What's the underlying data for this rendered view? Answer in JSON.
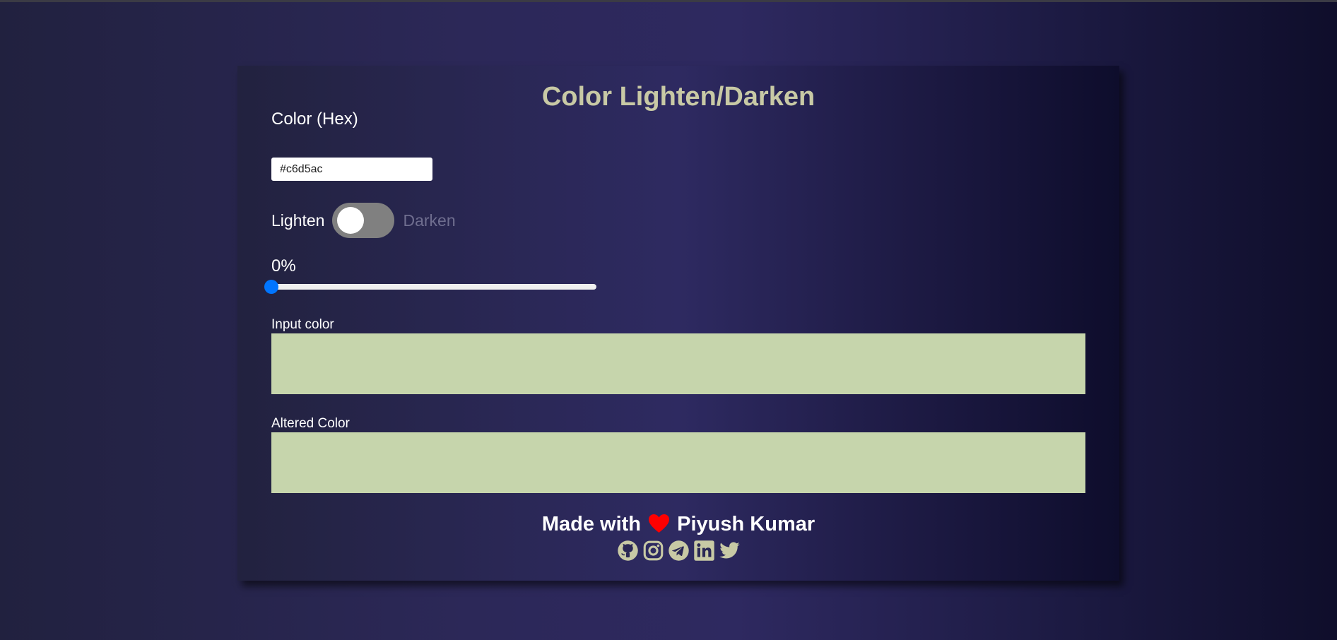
{
  "page": {
    "title": "Color Lighten/Darken"
  },
  "color_input": {
    "label": "Color (Hex)",
    "value": "#c6d5ac"
  },
  "mode_toggle": {
    "left_label": "Lighten",
    "right_label": "Darken",
    "selected": "Lighten"
  },
  "amount": {
    "label": "0%",
    "value_percent": 0
  },
  "swatches": {
    "input_label": "Input color",
    "input_color": "#c6d5ac",
    "altered_label": "Altered Color",
    "altered_color": "#c6d5ac"
  },
  "footer": {
    "made_with": "Made with",
    "author": "Piyush Kumar",
    "heart_color": "#ff0000",
    "social_icons": [
      "github-icon",
      "instagram-icon",
      "telegram-icon",
      "linkedin-icon",
      "twitter-icon"
    ]
  },
  "colors": {
    "title": "#c8c9a5",
    "icon": "#c8c9a5",
    "slider_thumb": "#0075ff",
    "toggle_track": "#808080"
  }
}
